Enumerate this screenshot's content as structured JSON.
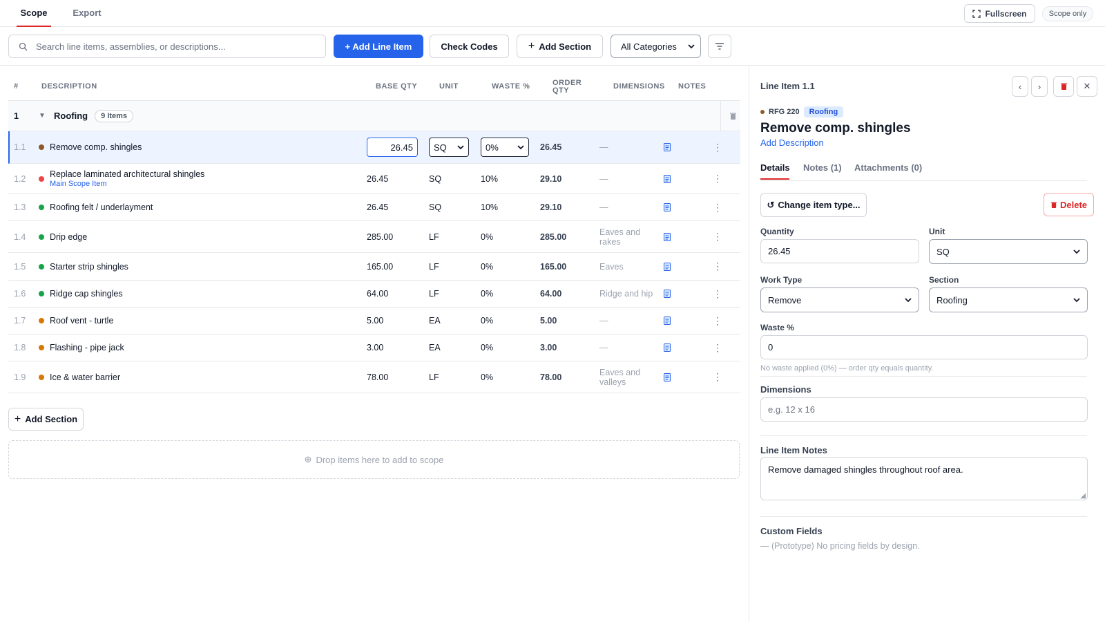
{
  "tabs": [
    {
      "label": "Scope",
      "active": true
    },
    {
      "label": "Export",
      "active": false
    }
  ],
  "top_actions": {
    "fullscreen": "Fullscreen",
    "scope_only": "Scope only"
  },
  "toolbar": {
    "search_placeholder": "Search line items, assemblies, or descriptions...",
    "add_line_item": "+ Add Line Item",
    "check_codes": "Check Codes",
    "add_section": "Add Section",
    "category_filter": "All Categories"
  },
  "table": {
    "headers": {
      "num": "#",
      "description": "DESCRIPTION",
      "base_qty": "BASE QTY",
      "unit": "UNIT",
      "waste": "WASTE %",
      "order_qty_1": "ORDER",
      "order_qty_2": "QTY",
      "dimensions": "DIMENSIONS",
      "notes": "NOTES"
    },
    "section": {
      "number": "1",
      "name": "Roofing",
      "count": "9 Items"
    },
    "rows": [
      {
        "num": "1.1",
        "desc": "Remove comp. shingles",
        "sub": "",
        "qty": "26.45",
        "unit": "SQ",
        "waste": "0%",
        "order": "26.45",
        "dims": "—",
        "dot": "#8b5a2b"
      },
      {
        "num": "1.2",
        "desc": "Replace laminated architectural shingles",
        "sub": "Main Scope Item",
        "qty": "26.45",
        "unit": "SQ",
        "waste": "10%",
        "order": "29.10",
        "dims": "—",
        "dot": "#ef4444"
      },
      {
        "num": "1.3",
        "desc": "Roofing felt / underlayment",
        "sub": "",
        "qty": "26.45",
        "unit": "SQ",
        "waste": "10%",
        "order": "29.10",
        "dims": "—",
        "dot": "#16a34a"
      },
      {
        "num": "1.4",
        "desc": "Drip edge",
        "sub": "",
        "qty": "285.00",
        "unit": "LF",
        "waste": "0%",
        "order": "285.00",
        "dims": "Eaves and rakes",
        "dot": "#16a34a"
      },
      {
        "num": "1.5",
        "desc": "Starter strip shingles",
        "sub": "",
        "qty": "165.00",
        "unit": "LF",
        "waste": "0%",
        "order": "165.00",
        "dims": "Eaves",
        "dot": "#16a34a"
      },
      {
        "num": "1.6",
        "desc": "Ridge cap shingles",
        "sub": "",
        "qty": "64.00",
        "unit": "LF",
        "waste": "0%",
        "order": "64.00",
        "dims": "Ridge and hip",
        "dot": "#16a34a"
      },
      {
        "num": "1.7",
        "desc": "Roof vent - turtle",
        "sub": "",
        "qty": "5.00",
        "unit": "EA",
        "waste": "0%",
        "order": "5.00",
        "dims": "—",
        "dot": "#d97706"
      },
      {
        "num": "1.8",
        "desc": "Flashing - pipe jack",
        "sub": "",
        "qty": "3.00",
        "unit": "EA",
        "waste": "0%",
        "order": "3.00",
        "dims": "—",
        "dot": "#d97706"
      },
      {
        "num": "1.9",
        "desc": "Ice & water barrier",
        "sub": "",
        "qty": "78.00",
        "unit": "LF",
        "waste": "0%",
        "order": "78.00",
        "dims": "Eaves and valleys",
        "dot": "#d97706"
      }
    ],
    "add_section": "Add Section",
    "dropzone": "Drop items here to add to scope"
  },
  "panel": {
    "title": "Line Item 1.1",
    "code": "RFG 220",
    "category": "Roofing",
    "item_name": "Remove comp. shingles",
    "add_description": "Add Description",
    "tabs": [
      "Details",
      "Notes (1)",
      "Attachments (0)"
    ],
    "change_type": "Change item type...",
    "delete": "Delete",
    "quantity_label": "Quantity",
    "quantity_value": "26.45",
    "unit_label": "Unit",
    "unit_value": "SQ",
    "work_type_label": "Work Type",
    "work_type_value": "Remove",
    "section_label": "Section",
    "section_value": "Roofing",
    "waste_label": "Waste %",
    "waste_value": "0",
    "waste_hint": "No waste applied (0%) — order qty equals quantity.",
    "dimensions_label": "Dimensions",
    "dimensions_placeholder": "e.g. 12 x 16",
    "notes_label": "Line Item Notes",
    "notes_value": "Remove damaged shingles throughout roof area.",
    "custom_fields_label": "Custom Fields",
    "custom_fields_text": "— (Prototype) No pricing fields by design."
  },
  "colors": {
    "accent": "#2563eb",
    "active_tab": "#dc2626",
    "danger": "#dc2626"
  }
}
